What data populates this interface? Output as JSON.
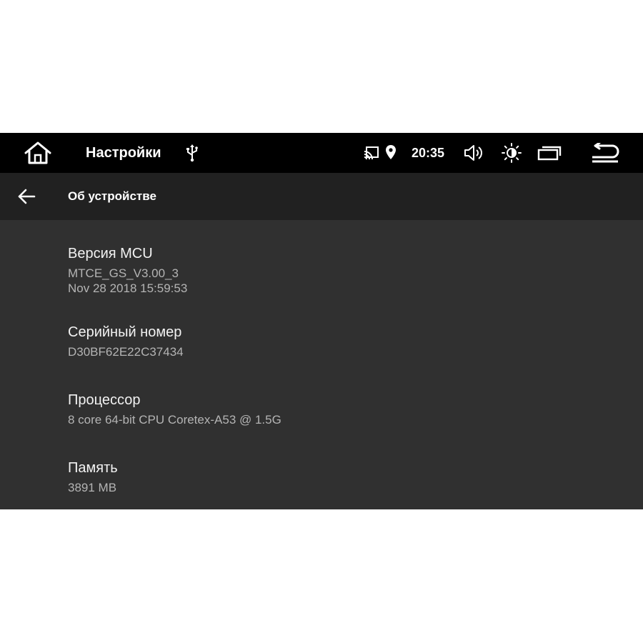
{
  "status_bar": {
    "home_icon": "home-icon",
    "app_title": "Настройки",
    "usb_icon": "usb-icon",
    "cast_icon": "cast-icon",
    "location_icon": "location-pin-icon",
    "time": "20:35",
    "volume_icon": "volume-icon",
    "brightness_icon": "brightness-icon",
    "recents_icon": "recent-apps-icon",
    "back_icon": "back-icon"
  },
  "toolbar": {
    "back_icon": "arrow-back-icon",
    "title": "Об устройстве"
  },
  "preferences": [
    {
      "title": "Версия MCU",
      "summary": "MTCE_GS_V3.00_3\nNov 28 2018 15:59:53"
    },
    {
      "title": "Серийный номер",
      "summary": "D30BF62E22C37434"
    },
    {
      "title": "Процессор",
      "summary": "8 core 64-bit CPU Coretex-A53 @ 1.5G"
    },
    {
      "title": "Память",
      "summary": "3891 MB"
    }
  ],
  "colors": {
    "status_bar_bg": "#000000",
    "toolbar_bg": "#212121",
    "content_bg": "#303030",
    "title_text": "#f2f2f2",
    "summary_text": "#b4b4b4"
  }
}
